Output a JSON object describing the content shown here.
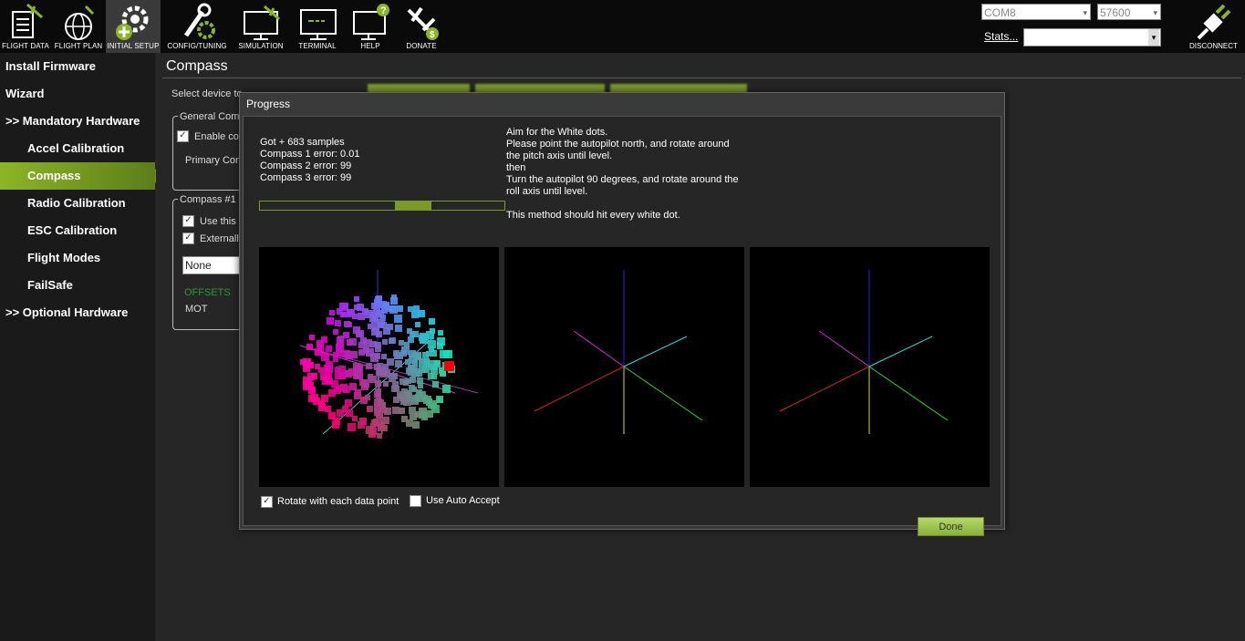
{
  "toolbar": {
    "items": [
      {
        "label": "FLIGHT DATA",
        "icon": "flight-data-icon"
      },
      {
        "label": "FLIGHT PLAN",
        "icon": "globe-icon"
      },
      {
        "label": "INITIAL SETUP",
        "icon": "gear-plus-icon"
      },
      {
        "label": "CONFIG/TUNING",
        "icon": "wrench-gear-icon"
      },
      {
        "label": "SIMULATION",
        "icon": "monitor-plane-icon"
      },
      {
        "label": "TERMINAL",
        "icon": "terminal-icon"
      },
      {
        "label": "HELP",
        "icon": "help-monitor-icon"
      },
      {
        "label": "DONATE",
        "icon": "donate-icon"
      }
    ],
    "port": "COM8",
    "baud": "57600",
    "stats_link": "Stats...",
    "disconnect_label": "DISCONNECT"
  },
  "sidebar": {
    "items": [
      {
        "label": "Install Firmware"
      },
      {
        "label": "Wizard"
      },
      {
        "label": ">> Mandatory Hardware"
      },
      {
        "label": "Accel Calibration"
      },
      {
        "label": "Compass"
      },
      {
        "label": "Radio Calibration"
      },
      {
        "label": "ESC Calibration"
      },
      {
        "label": "Flight Modes"
      },
      {
        "label": "FailSafe"
      },
      {
        "label": ">> Optional Hardware"
      }
    ],
    "active": "Compass"
  },
  "page": {
    "title": "Compass",
    "select_device": "Select device to",
    "general_group": "General Comp",
    "enable_label": "Enable co",
    "primary_label": "Primary Com",
    "compass1_group": "Compass #1 -",
    "use_this": "Use this",
    "externally": "Externally",
    "orientation": "None",
    "offsets": "OFFSETS",
    "mot": "MOT"
  },
  "dialog": {
    "title": "Progress",
    "stats_lines": [
      "Got + 683 samples",
      "Compass 1 error: 0.01",
      "Compass 2 error: 99",
      "Compass 3 error: 99"
    ],
    "instructions": [
      "Aim for the White dots.",
      "Please point the autopilot north, and rotate around",
      "the pitch axis until level.",
      "then",
      "Turn the autopilot 90 degrees, and rotate around the",
      "roll axis until level.",
      "",
      "This method should hit every white dot."
    ],
    "progress_fraction": 0.15,
    "rotate_label": "Rotate with each data point",
    "rotate_checked": true,
    "auto_accept_label": "Use Auto Accept",
    "auto_accept_checked": false,
    "done_label": "Done"
  },
  "colors": {
    "accent": "#8cb526",
    "background": "#262626",
    "sidebar": "#1a1a1a"
  }
}
